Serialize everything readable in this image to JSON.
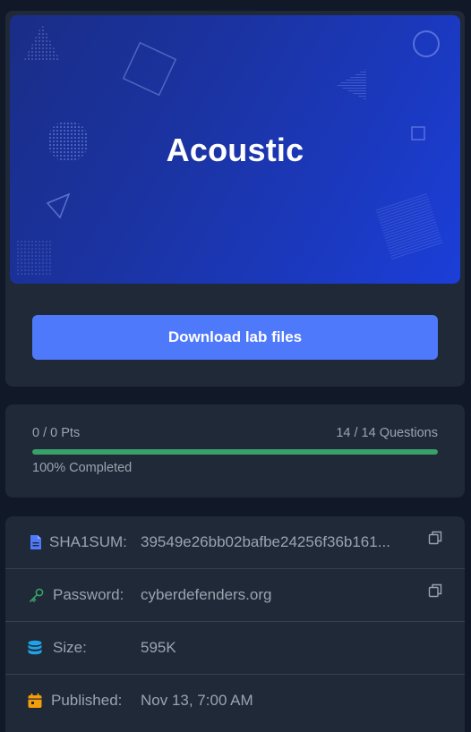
{
  "banner": {
    "title": "Acoustic"
  },
  "download": {
    "label": "Download lab files"
  },
  "progress": {
    "points": "0 / 0 Pts",
    "questions": "14 / 14 Questions",
    "completed_label": "100% Completed",
    "fraction": 1.0,
    "color": "#38a169"
  },
  "info": {
    "sha1": {
      "label": "SHA1SUM:",
      "value": "39549e26bb02bafbe24256f36b161...",
      "icon": "file-icon",
      "icon_color": "#4f79fb"
    },
    "password": {
      "label": "Password:",
      "value": "cyberdefenders.org",
      "icon": "key-icon",
      "icon_color": "#38a169"
    },
    "size": {
      "label": "Size:",
      "value": "595K",
      "icon": "database-icon",
      "icon_color": "#1fa2e6"
    },
    "published": {
      "label": "Published:",
      "value": "Nov 13, 7:00 AM",
      "icon": "calendar-icon",
      "icon_color": "#f59e0b"
    }
  },
  "colors": {
    "accent": "#4f79fb",
    "card": "#1f2937",
    "background": "#111827"
  }
}
